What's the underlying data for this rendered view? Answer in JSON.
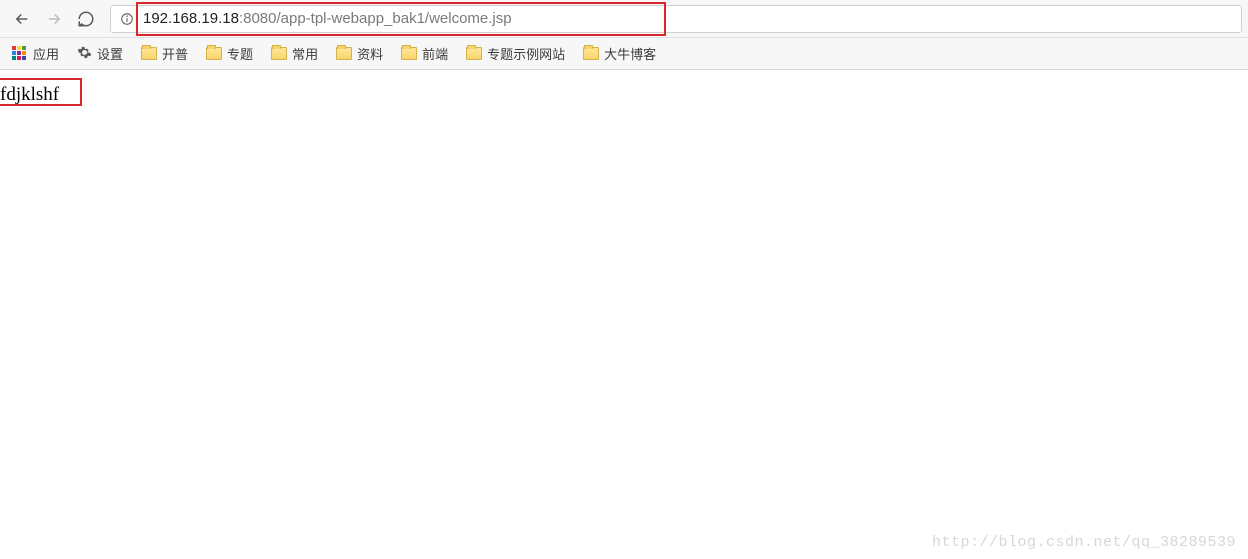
{
  "address_bar": {
    "url_host": "192.168.19.18",
    "url_rest": ":8080/app-tpl-webapp_bak1/welcome.jsp"
  },
  "bookmarks": {
    "apps_label": "应用",
    "settings_label": "设置",
    "folders": [
      {
        "label": "开普"
      },
      {
        "label": "专题"
      },
      {
        "label": "常用"
      },
      {
        "label": "资料"
      },
      {
        "label": "前端"
      },
      {
        "label": "专题示例网站"
      },
      {
        "label": "大牛博客"
      }
    ]
  },
  "page": {
    "content_text": "fdjklshf"
  },
  "watermark": "http://blog.csdn.net/qq_38289539"
}
